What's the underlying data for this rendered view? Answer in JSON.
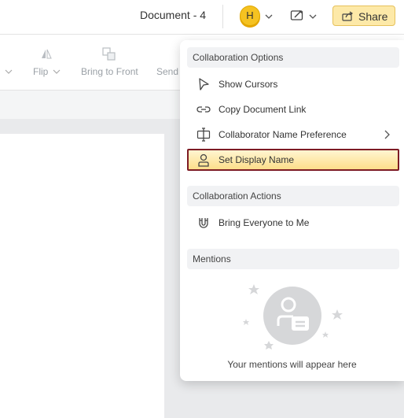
{
  "header": {
    "document_title": "Document - 4",
    "avatar_initial": "H",
    "share_label": "Share"
  },
  "toolbar": {
    "flip_label": "Flip",
    "bring_to_front_label": "Bring to Front",
    "send_label": "Send"
  },
  "menu": {
    "section_options": "Collaboration Options",
    "items": [
      {
        "label": "Show Cursors",
        "icon": "cursor-icon"
      },
      {
        "label": "Copy Document Link",
        "icon": "link-icon"
      },
      {
        "label": "Collaborator Name Preference",
        "icon": "text-cursor-icon"
      },
      {
        "label": "Set Display Name",
        "icon": "user-icon"
      }
    ],
    "section_actions": "Collaboration Actions",
    "bring_everyone": "Bring Everyone to Me",
    "section_mentions": "Mentions",
    "mentions_empty": "Your mentions will appear here"
  },
  "colors": {
    "accent": "#f5c221",
    "share_bg": "#fde9a8",
    "active_border": "#7d1b24"
  }
}
